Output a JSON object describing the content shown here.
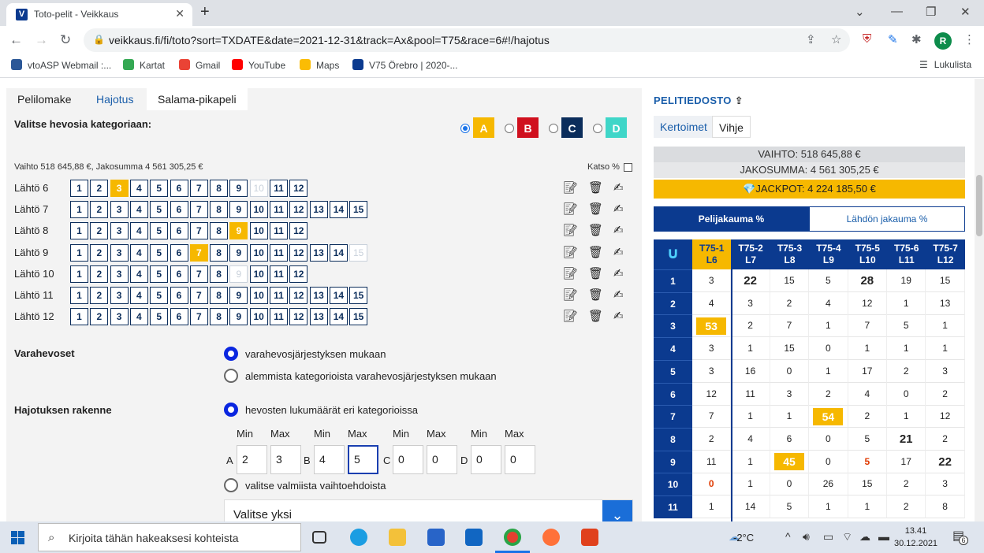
{
  "browser": {
    "tab_title": "Toto-pelit - Veikkaus",
    "new_tab": "+",
    "url": "veikkaus.fi/fi/toto?sort=TXDATE&date=2021-12-31&track=Ax&pool=T75&race=6#!/hajotus",
    "reading_list": "Lukulista",
    "avatar_letter": "R",
    "bookmarks": [
      {
        "label": "vtoASP Webmail :...",
        "color": "#2b5797"
      },
      {
        "label": "Kartat",
        "color": "#34a853"
      },
      {
        "label": "Gmail",
        "color": "#ea4335"
      },
      {
        "label": "YouTube",
        "color": "#ff0000"
      },
      {
        "label": "Maps",
        "color": "#fbbc04"
      },
      {
        "label": "V75 Örebro | 2020-...",
        "color": "#0b3a8f"
      }
    ]
  },
  "left": {
    "tabs": [
      "Pelilomake",
      "Hajotus",
      "Salama-pikapeli"
    ],
    "category_title": "Valitse hevosia kategoriaan:",
    "categories": [
      {
        "label": "A",
        "bg": "#f6b800",
        "fg": "#ffffff",
        "selected": true
      },
      {
        "label": "B",
        "bg": "#d0101e",
        "fg": "#ffffff",
        "selected": false
      },
      {
        "label": "C",
        "bg": "#0b2d5b",
        "fg": "#ffffff",
        "selected": false
      },
      {
        "label": "D",
        "bg": "#3fd6c8",
        "fg": "#ffffff",
        "selected": false
      }
    ],
    "pool_info": "Vaihto 518 645,88 €, Jakosumma 4 561 305,25 €",
    "katso": "Katso %",
    "races": [
      {
        "label": "Lähtö 6",
        "horses": 12,
        "selected": [
          3
        ],
        "scratched": [
          10
        ]
      },
      {
        "label": "Lähtö 7",
        "horses": 15,
        "selected": [],
        "scratched": []
      },
      {
        "label": "Lähtö 8",
        "horses": 12,
        "selected": [
          9
        ],
        "scratched": []
      },
      {
        "label": "Lähtö 9",
        "horses": 15,
        "selected": [
          7
        ],
        "scratched": [
          15
        ]
      },
      {
        "label": "Lähtö 10",
        "horses": 12,
        "selected": [],
        "scratched": [
          9
        ]
      },
      {
        "label": "Lähtö 11",
        "horses": 15,
        "selected": [],
        "scratched": []
      },
      {
        "label": "Lähtö 12",
        "horses": 15,
        "selected": [],
        "scratched": []
      }
    ],
    "reserve": {
      "label": "Varahevoset",
      "options": [
        "varahevosjärjestyksen mukaan",
        "alemmista kategorioista varahevosjärjestyksen mukaan"
      ]
    },
    "structure": {
      "label": "Hajotuksen rakenne",
      "option1": "hevosten lukumäärät eri kategorioissa",
      "option2": "valitse valmiista vaihtoehdoista",
      "min": "Min",
      "max": "Max",
      "groups": [
        {
          "cat": "A",
          "min": "2",
          "max": "3"
        },
        {
          "cat": "B",
          "min": "4",
          "max": "5"
        },
        {
          "cat": "C",
          "min": "0",
          "max": "0"
        },
        {
          "cat": "D",
          "min": "0",
          "max": "0"
        }
      ],
      "dropdown": "Valitse yksi"
    }
  },
  "right": {
    "title": "PELITIEDOSTO",
    "tabs": [
      "Kertoimet",
      "Vihje"
    ],
    "vaihto": "VAIHTO: 518 645,88 €",
    "jakosumma": "JAKOSUMMA: 4 561 305,25 €",
    "jackpot": "JACKPOT: 4 224 185,50 €",
    "dist_tabs": [
      "Pelijakauma %",
      "Lähdön jakauma %"
    ],
    "columns": [
      {
        "l1": "T75-1",
        "l2": "L6"
      },
      {
        "l1": "T75-2",
        "l2": "L7"
      },
      {
        "l1": "T75-3",
        "l2": "L8"
      },
      {
        "l1": "T75-4",
        "l2": "L9"
      },
      {
        "l1": "T75-5",
        "l2": "L10"
      },
      {
        "l1": "T75-6",
        "l2": "L11"
      },
      {
        "l1": "T75-7",
        "l2": "L12"
      }
    ],
    "rows": [
      {
        "n": "1",
        "v": [
          "3",
          "22",
          "15",
          "5",
          "28",
          "19",
          "15"
        ]
      },
      {
        "n": "2",
        "v": [
          "4",
          "3",
          "2",
          "4",
          "12",
          "1",
          "13"
        ]
      },
      {
        "n": "3",
        "v": [
          "53",
          "2",
          "7",
          "1",
          "7",
          "5",
          "1"
        ]
      },
      {
        "n": "4",
        "v": [
          "3",
          "1",
          "15",
          "0",
          "1",
          "1",
          "1"
        ]
      },
      {
        "n": "5",
        "v": [
          "3",
          "16",
          "0",
          "1",
          "17",
          "2",
          "3"
        ]
      },
      {
        "n": "6",
        "v": [
          "12",
          "11",
          "3",
          "2",
          "4",
          "0",
          "2"
        ]
      },
      {
        "n": "7",
        "v": [
          "7",
          "1",
          "1",
          "54",
          "2",
          "1",
          "12"
        ]
      },
      {
        "n": "8",
        "v": [
          "2",
          "4",
          "6",
          "0",
          "5",
          "21",
          "2"
        ]
      },
      {
        "n": "9",
        "v": [
          "11",
          "1",
          "45",
          "0",
          "5",
          "17",
          "22"
        ]
      },
      {
        "n": "10",
        "v": [
          "0",
          "1",
          "0",
          "26",
          "15",
          "2",
          "3"
        ]
      },
      {
        "n": "11",
        "v": [
          "1",
          "14",
          "5",
          "1",
          "1",
          "2",
          "8"
        ]
      }
    ]
  },
  "taskbar": {
    "search_placeholder": "Kirjoita tähän hakeaksesi kohteista",
    "temp": "-2°C",
    "time": "13.41",
    "date": "30.12.2021",
    "notif": "6"
  }
}
